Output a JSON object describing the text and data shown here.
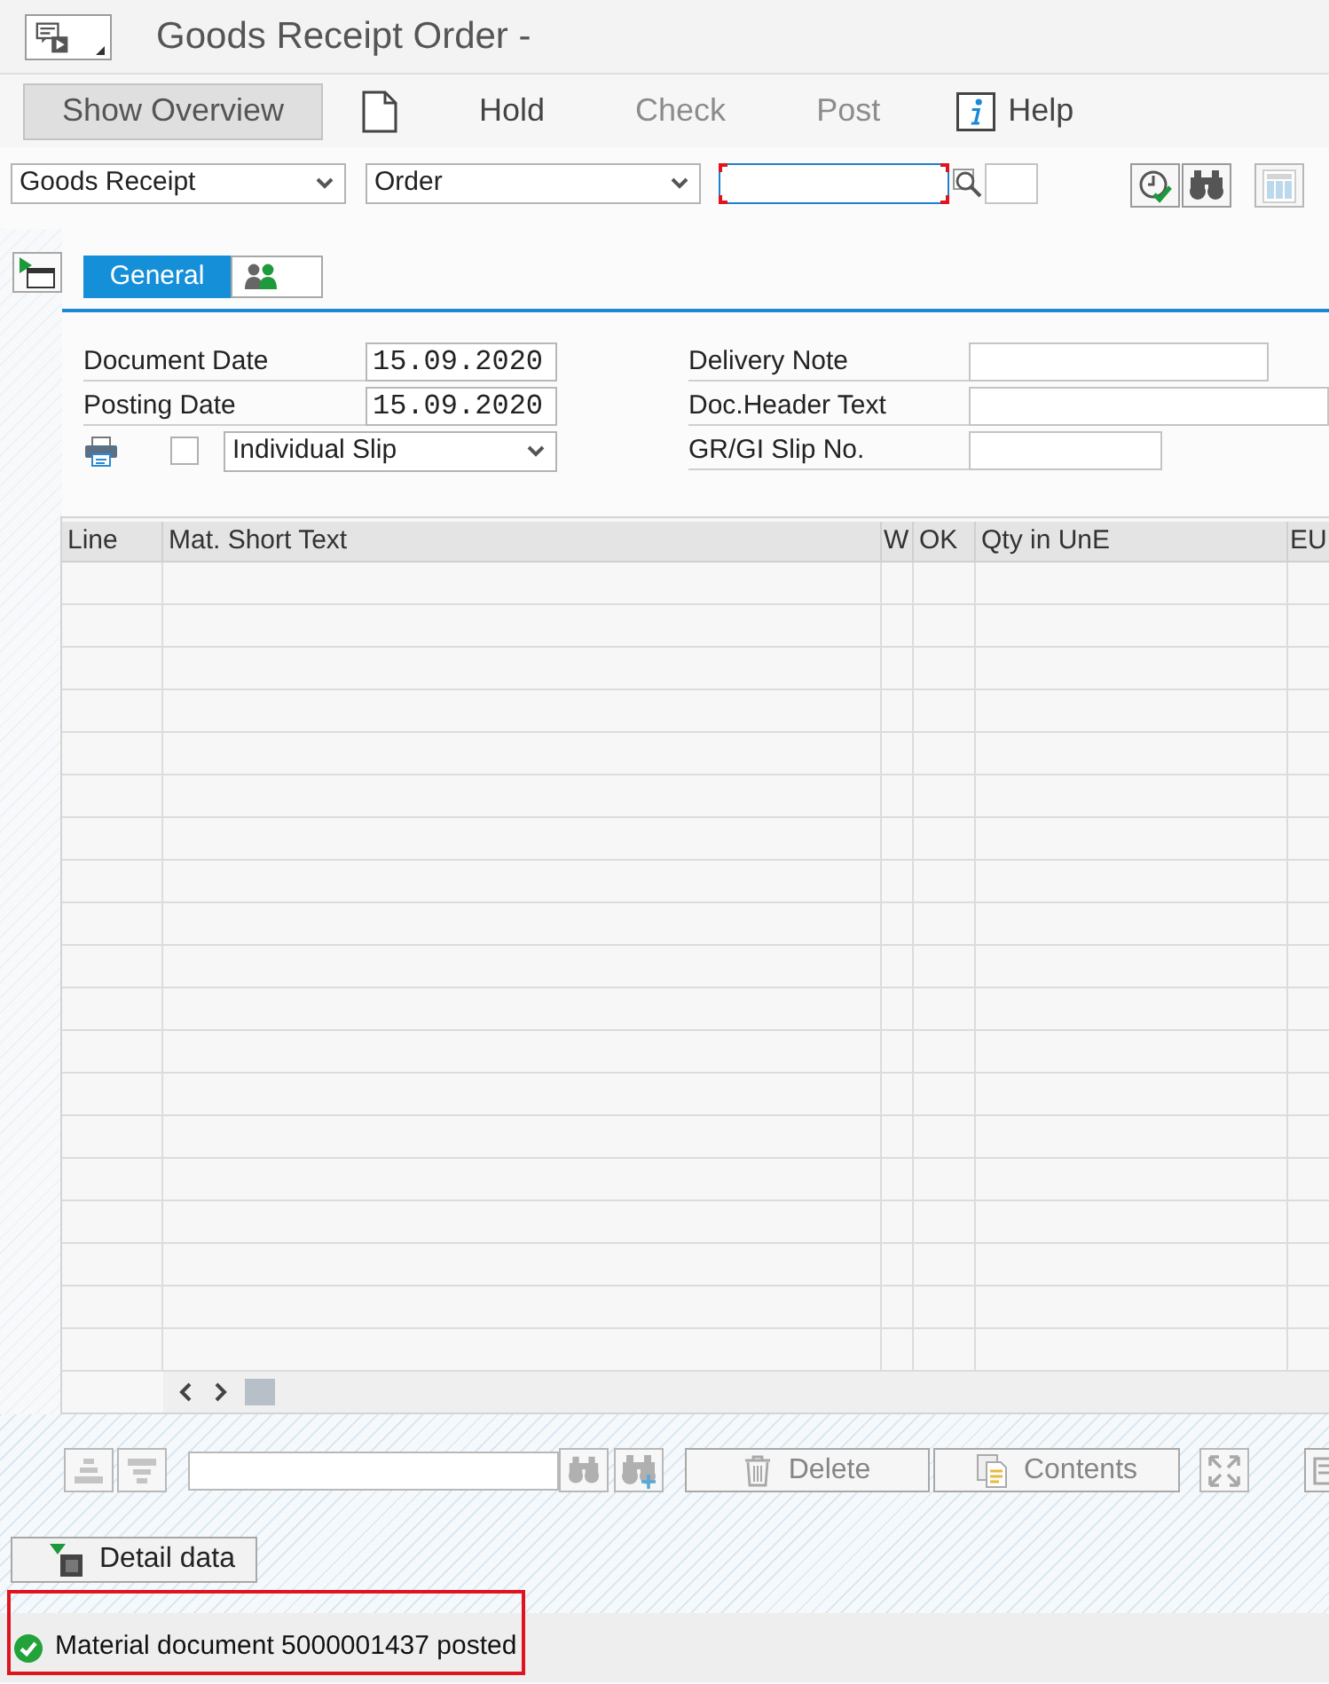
{
  "window": {
    "title": "Goods Receipt Order -"
  },
  "toolbar": {
    "overview_button": {
      "label": "Show Overview"
    },
    "actions": [
      {
        "label": "Hold",
        "disabled": false
      },
      {
        "label": "Check",
        "disabled": true
      },
      {
        "label": "Post",
        "disabled": true
      }
    ],
    "help": {
      "label": "Help"
    }
  },
  "selection": {
    "dropdowns": [
      {
        "value": "Goods Receipt"
      },
      {
        "value": "Order"
      }
    ],
    "search": {
      "focused": true,
      "required": true
    }
  },
  "tabs": [
    {
      "kind": "text",
      "label": "General",
      "selected": true
    },
    {
      "kind": "icon",
      "selected": false
    }
  ],
  "header": {
    "left_fields": [
      {
        "label": "Document Date",
        "value": "15.09.2020"
      },
      {
        "label": "Posting Date",
        "value": "15.09.2020"
      }
    ],
    "print": {
      "checked": false,
      "slip": "Individual Slip"
    },
    "right_fields": [
      {
        "label": "Delivery Note"
      },
      {
        "label": "Doc.Header Text"
      },
      {
        "label": "GR/GI Slip No."
      }
    ]
  },
  "table": {
    "columns": [
      "Line",
      "Mat. Short Text",
      "W",
      "OK",
      "Qty in UnE",
      "EU"
    ]
  },
  "table_toolbar": {
    "buttons": [
      {
        "label": "Delete",
        "disabled": true
      },
      {
        "label": "Contents",
        "disabled": true
      }
    ]
  },
  "detail_button": {
    "label": "Detail data"
  },
  "status_bar": {
    "kind": "success",
    "message": "Material document 5000001437 posted",
    "highlighted": true
  }
}
